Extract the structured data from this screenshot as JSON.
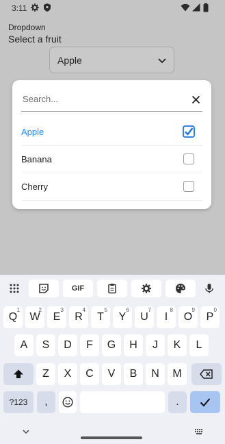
{
  "status_bar": {
    "time": "3:11",
    "icons": [
      "gear-icon",
      "shield-icon",
      "wifi-icon",
      "signal-icon",
      "battery-icon"
    ]
  },
  "app": {
    "title": "Dropdown",
    "label": "Select a fruit",
    "selected_value": "Apple"
  },
  "dialog": {
    "search_placeholder": "Search...",
    "options": [
      {
        "label": "Apple",
        "checked": true
      },
      {
        "label": "Banana",
        "checked": false
      },
      {
        "label": "Cherry",
        "checked": false
      }
    ]
  },
  "keyboard": {
    "toolbar": {
      "gif_label": "GIF",
      "icons": [
        "apps-grid-icon",
        "sticker-icon",
        "gif-icon",
        "clipboard-icon",
        "settings-gear-icon",
        "palette-icon",
        "microphone-icon"
      ]
    },
    "row1": [
      {
        "label": "Q",
        "hint": "1"
      },
      {
        "label": "W",
        "hint": "2"
      },
      {
        "label": "E",
        "hint": "3"
      },
      {
        "label": "R",
        "hint": "4"
      },
      {
        "label": "T",
        "hint": "5"
      },
      {
        "label": "Y",
        "hint": "6"
      },
      {
        "label": "U",
        "hint": "7"
      },
      {
        "label": "I",
        "hint": "8"
      },
      {
        "label": "O",
        "hint": "9"
      },
      {
        "label": "P",
        "hint": "0"
      }
    ],
    "row2": [
      "A",
      "S",
      "D",
      "F",
      "G",
      "H",
      "J",
      "K",
      "L"
    ],
    "row3": [
      "Z",
      "X",
      "C",
      "V",
      "B",
      "N",
      "M"
    ],
    "row4": {
      "symbols_label": "?123",
      "comma_label": ",",
      "period_label": "."
    }
  },
  "colors": {
    "accent": "#1a8cff",
    "overlay_background": "#c5c5c5",
    "keyboard_background": "#eef0f5",
    "checkbox_active": "#1a73e8"
  }
}
